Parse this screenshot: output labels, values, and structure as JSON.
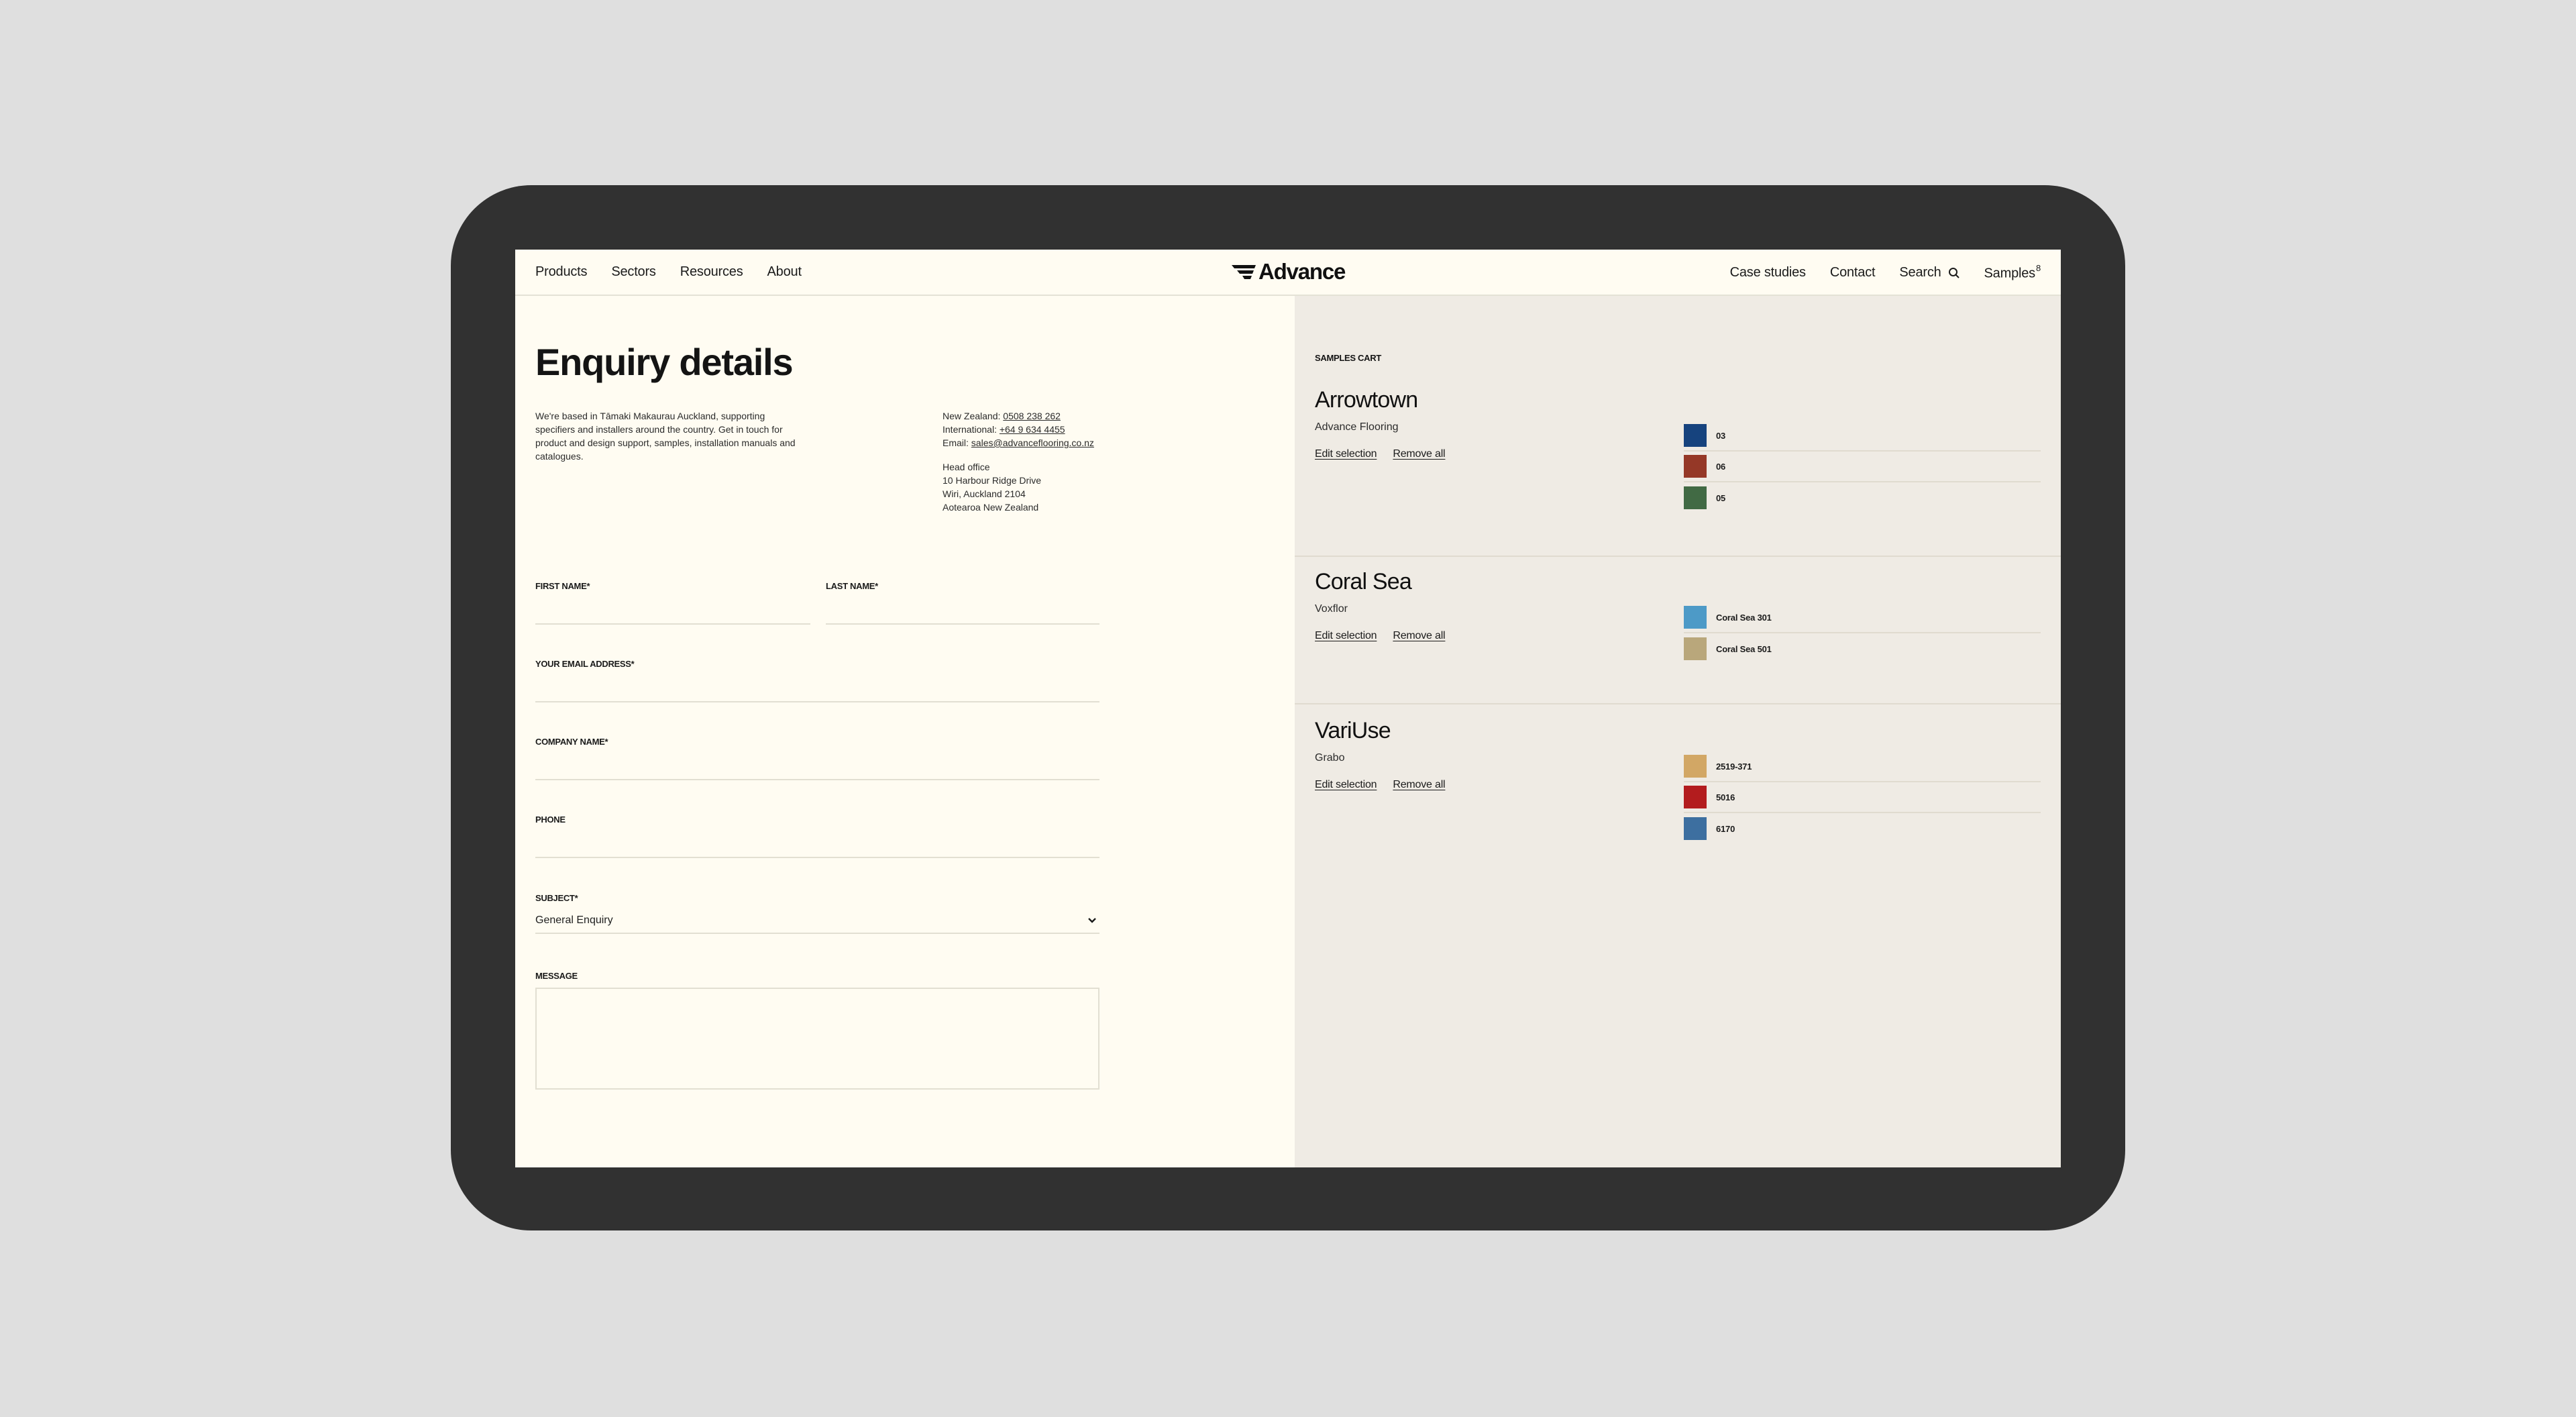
{
  "nav": {
    "left": [
      "Products",
      "Sectors",
      "Resources",
      "About"
    ],
    "logo": "Advance",
    "case_studies": "Case studies",
    "contact": "Contact",
    "search": "Search",
    "samples": "Samples",
    "samples_count": "8"
  },
  "enquiry": {
    "title": "Enquiry details",
    "intro": "We're based in Tāmaki Makaurau Auckland, supporting specifiers and installers around the country. Get in touch for product and design support, samples, installation manuals and catalogues.",
    "nz_label": "New Zealand:",
    "nz_phone": "0508 238 262",
    "intl_label": "International:",
    "intl_phone": "+64 9 634 4455",
    "email_label": "Email:",
    "email": "sales@advanceflooring.co.nz",
    "office_title": "Head office",
    "office_line1": "10 Harbour Ridge Drive",
    "office_line2": "Wiri, Auckland 2104",
    "office_line3": "Aotearoa New Zealand"
  },
  "form": {
    "first_name": "FIRST NAME*",
    "last_name": "LAST NAME*",
    "email": "YOUR EMAIL ADDRESS*",
    "company": "COMPANY NAME*",
    "phone": "PHONE",
    "subject": "SUBJECT*",
    "subject_value": "General Enquiry",
    "message": "MESSAGE"
  },
  "cart": {
    "label": "SAMPLES CART",
    "edit_label": "Edit selection",
    "remove_label": "Remove all",
    "sections": [
      {
        "title": "Arrowtown",
        "brand": "Advance Flooring",
        "samples": [
          {
            "name": "03",
            "color": "#16437e"
          },
          {
            "name": "06",
            "color": "#953827"
          },
          {
            "name": "05",
            "color": "#416a44"
          }
        ]
      },
      {
        "title": "Coral Sea",
        "brand": "Voxflor",
        "samples": [
          {
            "name": "Coral Sea 301",
            "color": "#4d9ac7"
          },
          {
            "name": "Coral Sea 501",
            "color": "#b9a77b"
          }
        ]
      },
      {
        "title": "VariUse",
        "brand": "Grabo",
        "samples": [
          {
            "name": "2519-371",
            "color": "#d2a765"
          },
          {
            "name": "5016",
            "color": "#b31c1e"
          },
          {
            "name": "6170",
            "color": "#3d6fa0"
          }
        ]
      }
    ]
  }
}
